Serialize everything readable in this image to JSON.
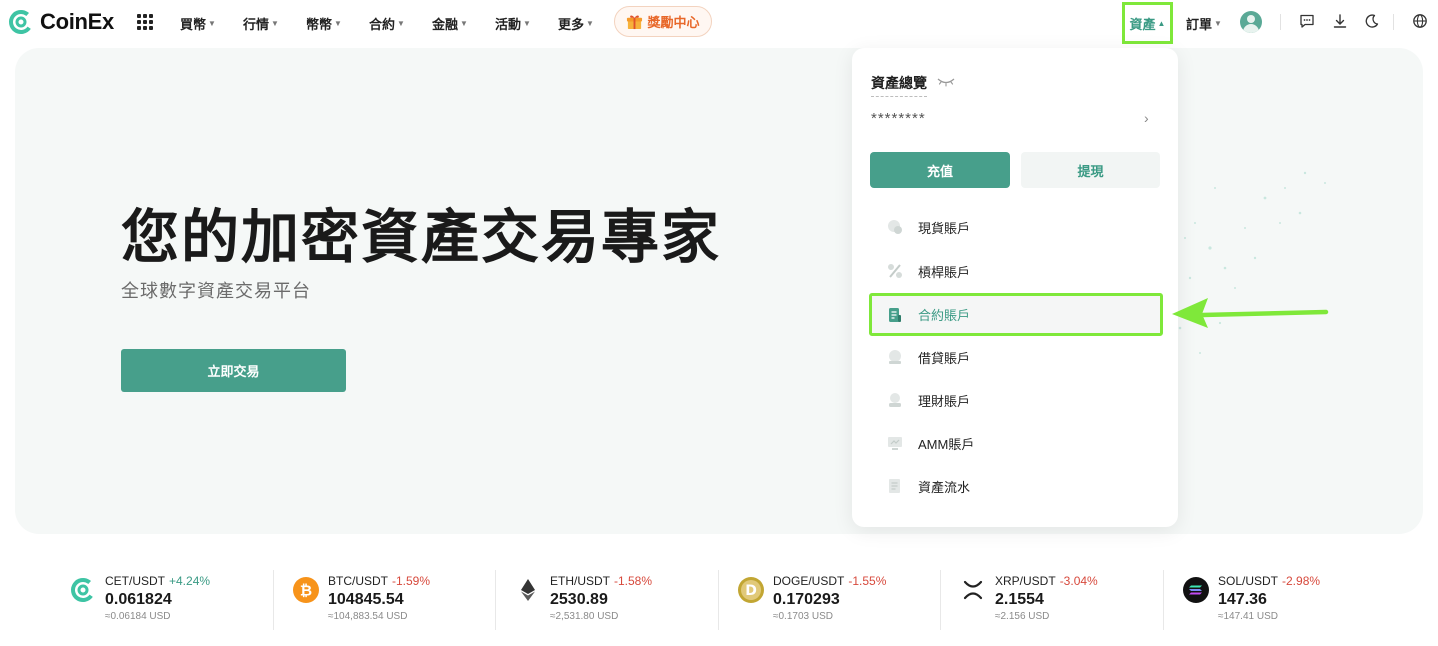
{
  "brand": {
    "name": "CoinEx",
    "accent": "#479f8b",
    "highlight": "#7fe83a"
  },
  "nav": {
    "menu": [
      {
        "label": "買幣",
        "icon": "chevron-down-icon"
      },
      {
        "label": "行情",
        "icon": "chevron-down-icon"
      },
      {
        "label": "幣幣",
        "icon": "chevron-down-icon"
      },
      {
        "label": "合約",
        "icon": "chevron-down-icon"
      },
      {
        "label": "金融",
        "icon": "chevron-down-icon"
      },
      {
        "label": "活動",
        "icon": "chevron-down-icon"
      },
      {
        "label": "更多",
        "icon": "chevron-down-icon"
      }
    ],
    "reward_label": "獎勵中心",
    "assets_label": "資產",
    "orders_label": "訂單",
    "right_icons": [
      "chat-icon",
      "download-icon",
      "moon-icon",
      "globe-icon"
    ]
  },
  "hero": {
    "title": "您的加密資產交易專家",
    "subtitle": "全球數字資產交易平台",
    "cta_label": "立即交易"
  },
  "assets_dropdown": {
    "title": "資產總覽",
    "balance_masked": "********",
    "deposit_label": "充值",
    "withdraw_label": "提現",
    "items": [
      {
        "label": "現貨賬戶",
        "icon": "spot-account-icon"
      },
      {
        "label": "槓桿賬戶",
        "icon": "margin-account-icon"
      },
      {
        "label": "合約賬戶",
        "icon": "futures-account-icon",
        "active": true
      },
      {
        "label": "借貸賬戶",
        "icon": "loan-account-icon"
      },
      {
        "label": "理財賬戶",
        "icon": "financial-account-icon"
      },
      {
        "label": "AMM賬戶",
        "icon": "amm-account-icon"
      },
      {
        "label": "資產流水",
        "icon": "asset-history-icon"
      }
    ]
  },
  "ticker": [
    {
      "pair": "CET/USDT",
      "change": "+4.24%",
      "dir": "up",
      "price": "0.061824",
      "usd": "≈0.06184 USD",
      "icon": "cet-coin-icon"
    },
    {
      "pair": "BTC/USDT",
      "change": "-1.59%",
      "dir": "down",
      "price": "104845.54",
      "usd": "≈104,883.54 USD",
      "icon": "btc-coin-icon"
    },
    {
      "pair": "ETH/USDT",
      "change": "-1.58%",
      "dir": "down",
      "price": "2530.89",
      "usd": "≈2,531.80 USD",
      "icon": "eth-coin-icon"
    },
    {
      "pair": "DOGE/USDT",
      "change": "-1.55%",
      "dir": "down",
      "price": "0.170293",
      "usd": "≈0.1703 USD",
      "icon": "doge-coin-icon"
    },
    {
      "pair": "XRP/USDT",
      "change": "-3.04%",
      "dir": "down",
      "price": "2.1554",
      "usd": "≈2.156 USD",
      "icon": "xrp-coin-icon"
    },
    {
      "pair": "SOL/USDT",
      "change": "-2.98%",
      "dir": "down",
      "price": "147.36",
      "usd": "≈147.41 USD",
      "icon": "sol-coin-icon"
    }
  ]
}
